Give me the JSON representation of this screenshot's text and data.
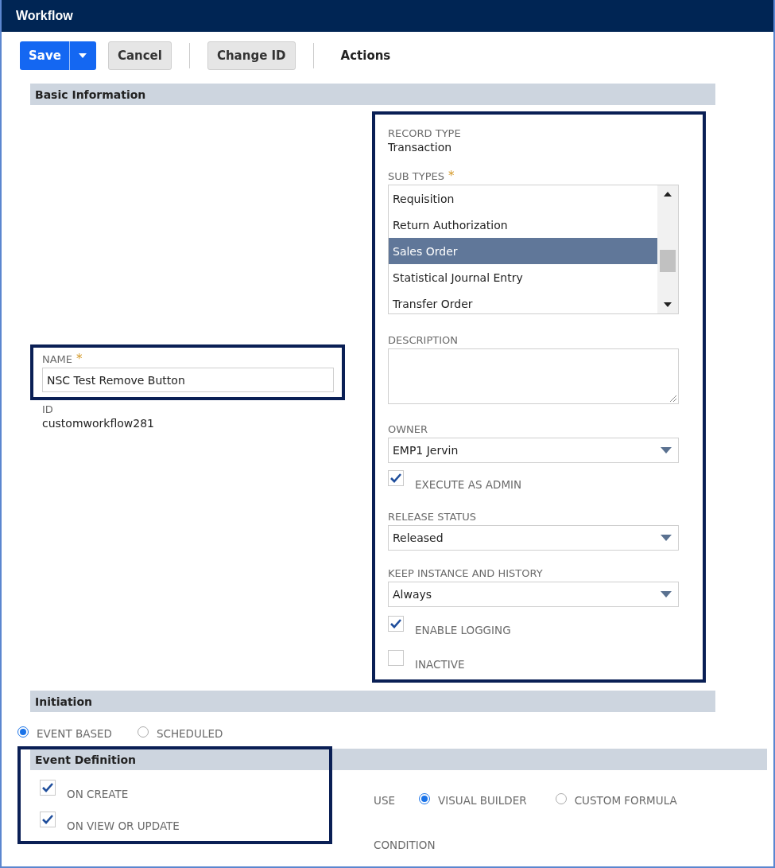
{
  "window": {
    "title": "Workflow"
  },
  "toolbar": {
    "buttons": [
      {
        "label": "Save",
        "kind": "primary"
      },
      {
        "label": "Cancel",
        "kind": "default"
      },
      {
        "label": "Change ID",
        "kind": "default"
      }
    ],
    "actions": "Actions"
  },
  "basic_information": {
    "title": "Basic Information",
    "name": {
      "label": "NAME",
      "required_mark": "*",
      "value": "NSC Test Remove Button"
    },
    "id": {
      "label": "ID",
      "value": "customworkflow281"
    },
    "record_type": {
      "label": "RECORD TYPE",
      "value": "Transaction"
    },
    "sub_types": {
      "label": "SUB TYPES",
      "required_mark": "*",
      "items": [
        {
          "label": "Requisition",
          "selected": false
        },
        {
          "label": "Return Authorization",
          "selected": false
        },
        {
          "label": "Sales Order",
          "selected": true
        },
        {
          "label": "Statistical Journal Entry",
          "selected": false
        },
        {
          "label": "Transfer Order",
          "selected": false
        }
      ]
    },
    "description": {
      "label": "DESCRIPTION"
    },
    "owner": {
      "label": "OWNER",
      "value": "EMP1 Jervin"
    },
    "execute_as_admin": {
      "label": "EXECUTE AS ADMIN",
      "checked": true
    },
    "release_status": {
      "label": "RELEASE STATUS",
      "value": "Released"
    },
    "keep_instance_and_history": {
      "label": "KEEP INSTANCE AND HISTORY",
      "value": "Always"
    },
    "enable_logging": {
      "label": "ENABLE LOGGING",
      "checked": true
    },
    "inactive": {
      "label": "INACTIVE",
      "checked": false
    }
  },
  "initiation": {
    "title": "Initiation",
    "options": [
      {
        "label": "EVENT BASED",
        "selected": true
      },
      {
        "label": "SCHEDULED",
        "selected": false
      }
    ]
  },
  "event_definition": {
    "title": "Event Definition",
    "events": [
      {
        "label": "ON CREATE",
        "checked": true
      },
      {
        "label": "ON VIEW OR UPDATE",
        "checked": true
      }
    ],
    "use": {
      "label": "USE",
      "options": [
        {
          "label": "VISUAL BUILDER",
          "selected": true
        },
        {
          "label": "CUSTOM FORMULA",
          "selected": false
        }
      ]
    },
    "condition": {
      "label": "CONDITION"
    }
  }
}
